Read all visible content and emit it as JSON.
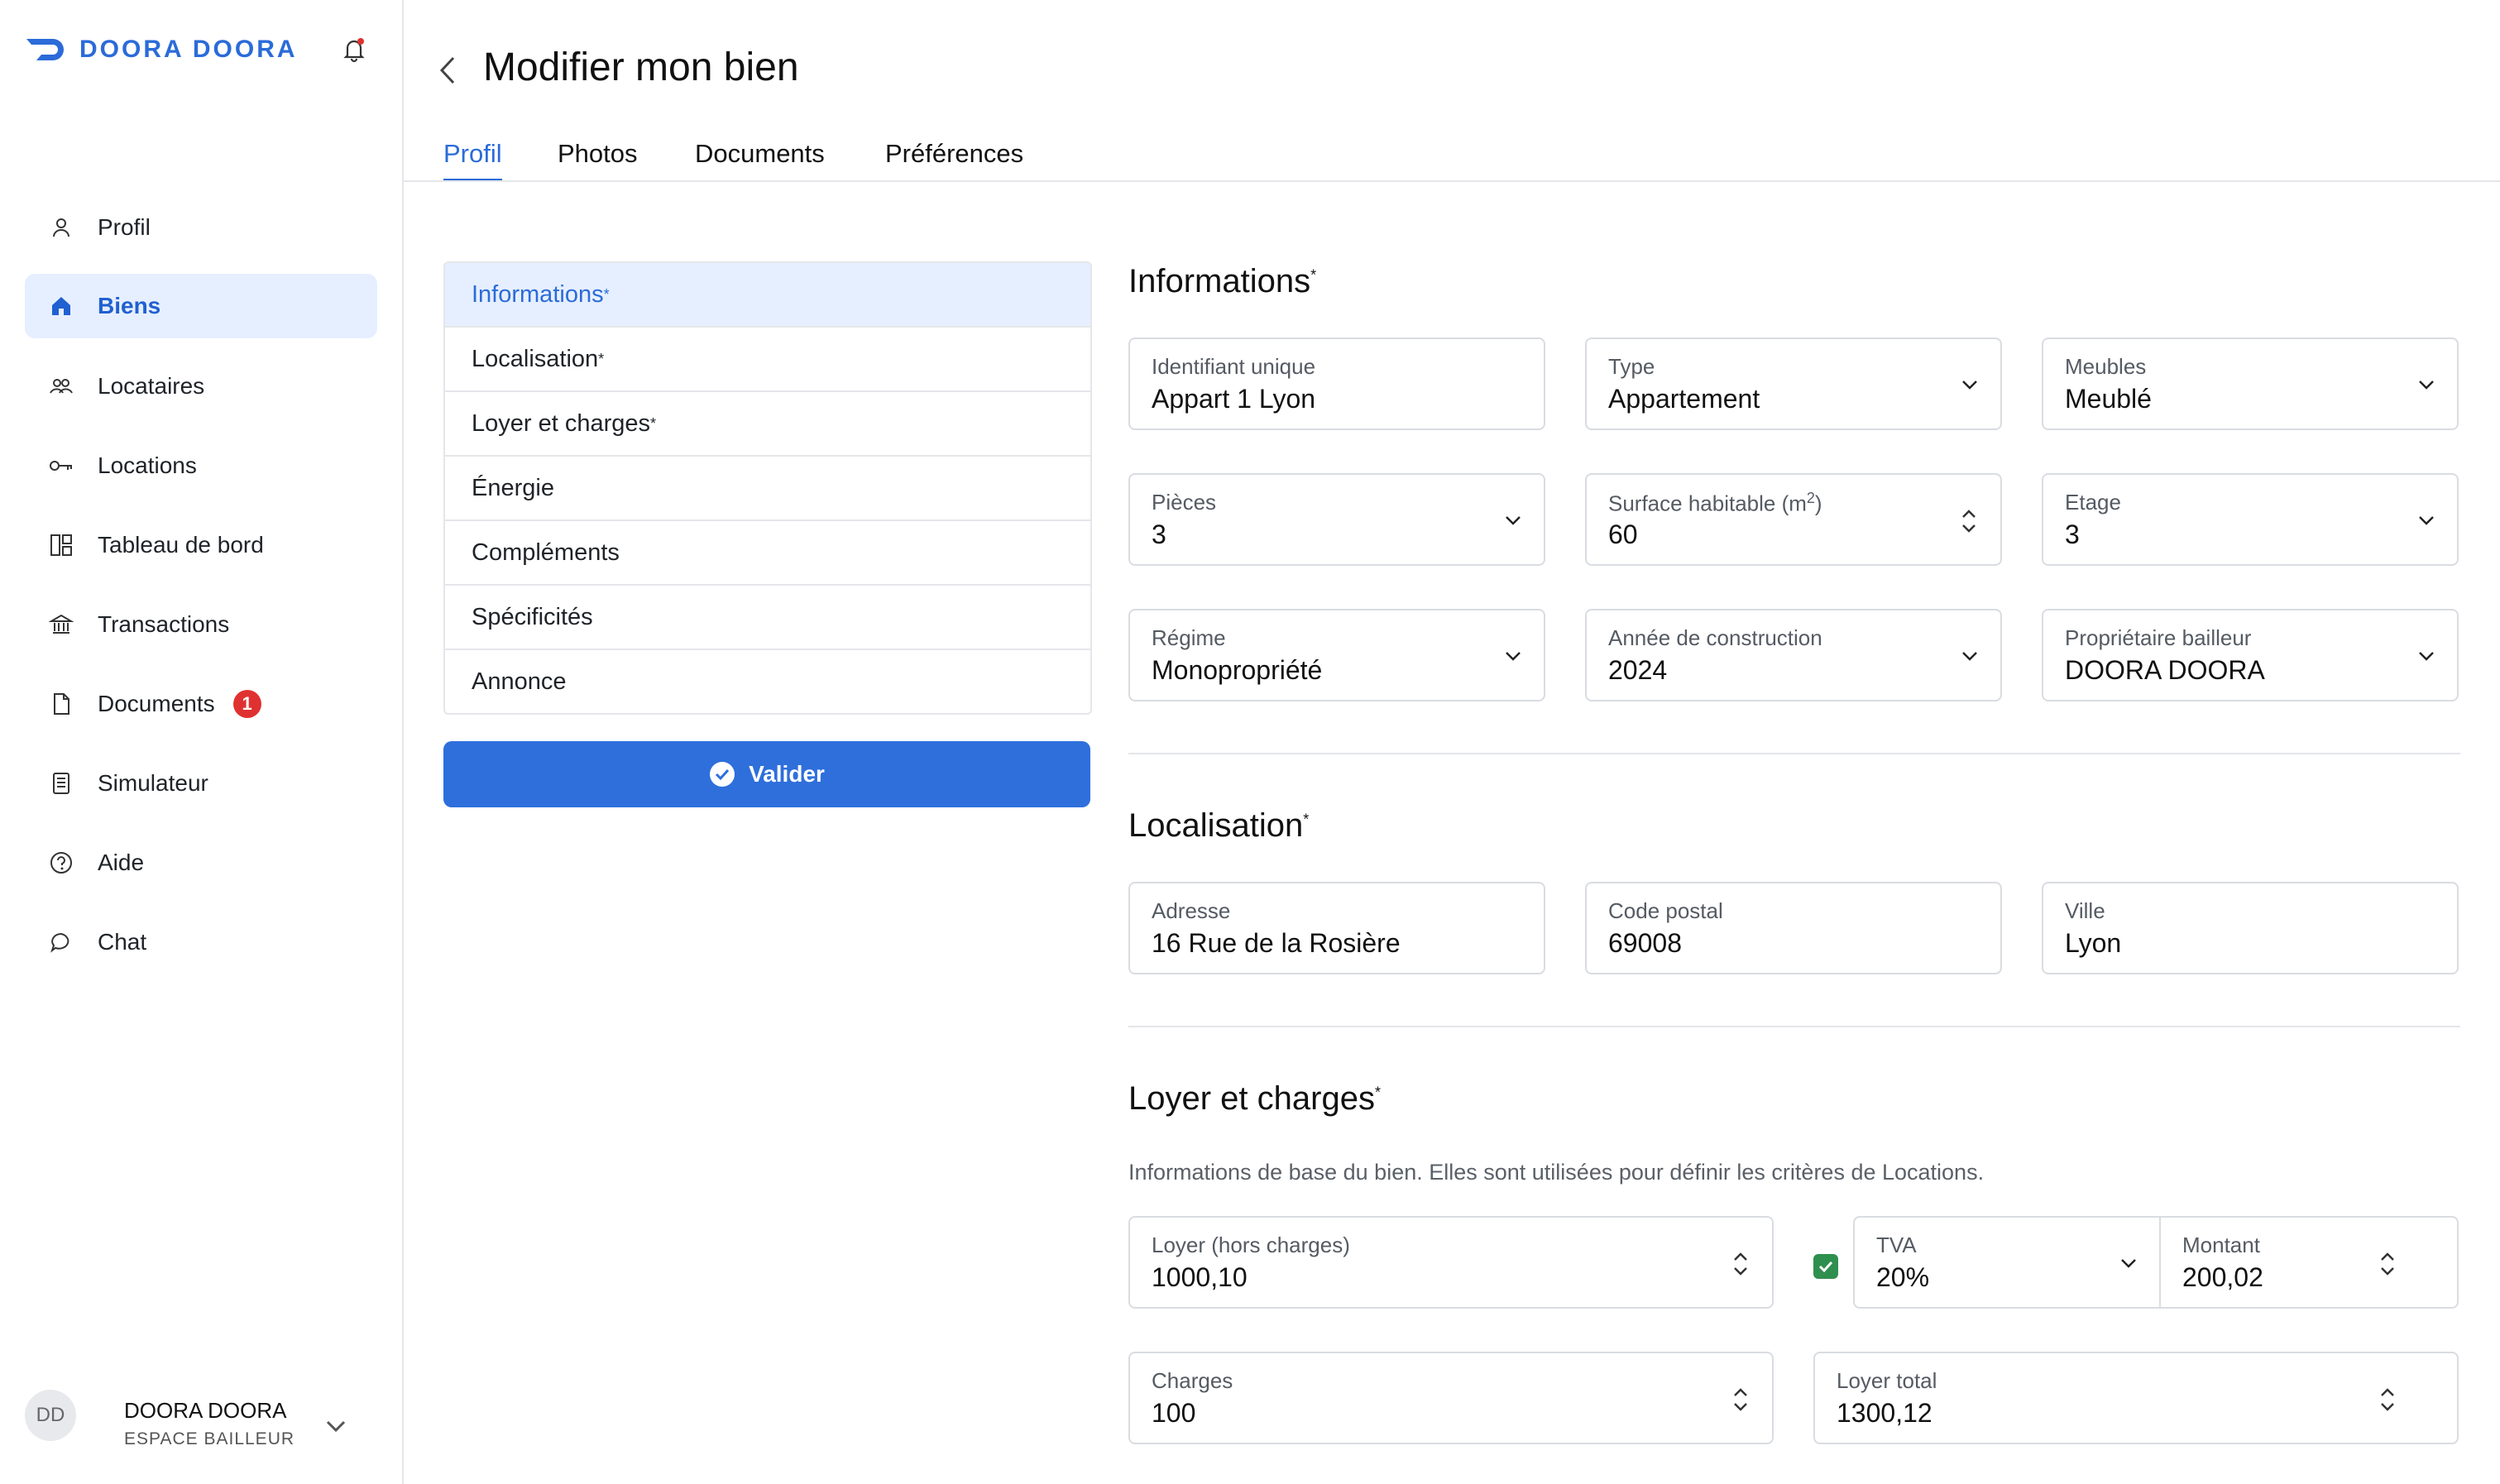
{
  "brand": {
    "name": "DOORA DOORA",
    "color": "#2b6bd9"
  },
  "sidebar": {
    "items": [
      {
        "label": "Profil",
        "icon": "user-icon"
      },
      {
        "label": "Biens",
        "icon": "home-icon",
        "active": true
      },
      {
        "label": "Locataires",
        "icon": "users-icon"
      },
      {
        "label": "Locations",
        "icon": "key-icon"
      },
      {
        "label": "Tableau de bord",
        "icon": "dashboard-icon"
      },
      {
        "label": "Transactions",
        "icon": "bank-icon"
      },
      {
        "label": "Documents",
        "icon": "document-icon",
        "badge": "1"
      },
      {
        "label": "Simulateur",
        "icon": "calculator-icon"
      },
      {
        "label": "Aide",
        "icon": "help-icon"
      },
      {
        "label": "Chat",
        "icon": "chat-icon"
      }
    ],
    "user": {
      "initials": "DD",
      "name": "DOORA DOORA",
      "role": "ESPACE BAILLEUR"
    }
  },
  "header": {
    "title": "Modifier mon bien",
    "tabs": [
      "Profil",
      "Photos",
      "Documents",
      "Préférences"
    ]
  },
  "sections": [
    "Informations",
    "Localisation",
    "Loyer et charges",
    "Énergie",
    "Compléments",
    "Spécificités",
    "Annonce"
  ],
  "submit_label": "Valider",
  "informations": {
    "title": "Informations",
    "fields": [
      {
        "label": "Identifiant unique",
        "value": "Appart 1 Lyon"
      },
      {
        "label": "Type",
        "value": "Appartement"
      },
      {
        "label": "Meubles",
        "value": "Meublé"
      },
      {
        "label": "Pièces",
        "value": "3"
      },
      {
        "label": "Surface habitable (m",
        "label_sup": "2",
        "label_end": ")",
        "value": "60"
      },
      {
        "label": "Etage",
        "value": "3"
      },
      {
        "label": "Régime",
        "value": "Monopropriété"
      },
      {
        "label": "Année de construction",
        "value": "2024"
      },
      {
        "label": "Propriétaire bailleur",
        "value": "DOORA DOORA"
      }
    ]
  },
  "localisation": {
    "title": "Localisation",
    "fields": [
      {
        "label": "Adresse",
        "value": "16 Rue de la Rosière"
      },
      {
        "label": "Code postal",
        "value": "69008"
      },
      {
        "label": "Ville",
        "value": "Lyon"
      }
    ]
  },
  "loyer": {
    "title": "Loyer et charges",
    "description": "Informations de base du bien. Elles sont utilisées pour définir les critères de Locations.",
    "loyer_hc": {
      "label": "Loyer (hors charges)",
      "value": "1000,10"
    },
    "tva": {
      "label": "TVA",
      "value": "20%",
      "checked": true
    },
    "montant": {
      "label": "Montant",
      "value": "200,02"
    },
    "charges": {
      "label": "Charges",
      "value": "100"
    },
    "total": {
      "label": "Loyer total",
      "value": "1300,12"
    }
  }
}
